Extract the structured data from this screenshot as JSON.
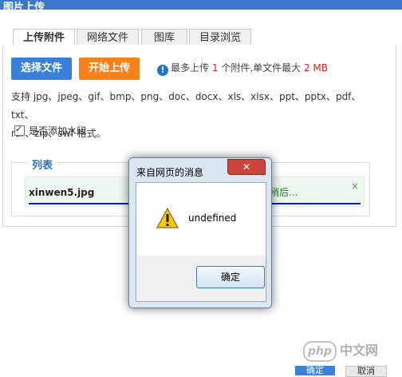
{
  "window": {
    "title": "图片上传"
  },
  "tabs": [
    {
      "label": "上传附件",
      "active": true
    },
    {
      "label": "网络文件",
      "active": false
    },
    {
      "label": "图库",
      "active": false
    },
    {
      "label": "目录浏览",
      "active": false
    }
  ],
  "buttons": {
    "select_label": "选择文件",
    "start_label": "开始上传"
  },
  "info": {
    "prefix": "最多上传",
    "count": "1",
    "middle": "个附件,单文件最大",
    "size": "2 MB"
  },
  "support": {
    "line1": "支持 jpg、jpeg、gif、bmp、png、doc、docx、xls、xlsx、ppt、pptx、pdf、txt、",
    "line2": "rar、zip、swf 格式。"
  },
  "watermark": {
    "label": "是否添加水印",
    "checked": true
  },
  "list": {
    "legend": "列表",
    "file": {
      "name": "xinwen5.jpg",
      "status": "稍后...",
      "close": "×"
    }
  },
  "message_box": {
    "title": "来自网页的消息",
    "close": "✕",
    "text": "undefined",
    "ok_label": "确定"
  },
  "footer": {
    "confirm_label": "确定",
    "cancel_label": "取消"
  },
  "site_watermark": {
    "badge": "php",
    "text": "中文网"
  },
  "colors": {
    "accent": "#3a80d8",
    "orange": "#f48119",
    "titlebar": "#3b78c9"
  }
}
